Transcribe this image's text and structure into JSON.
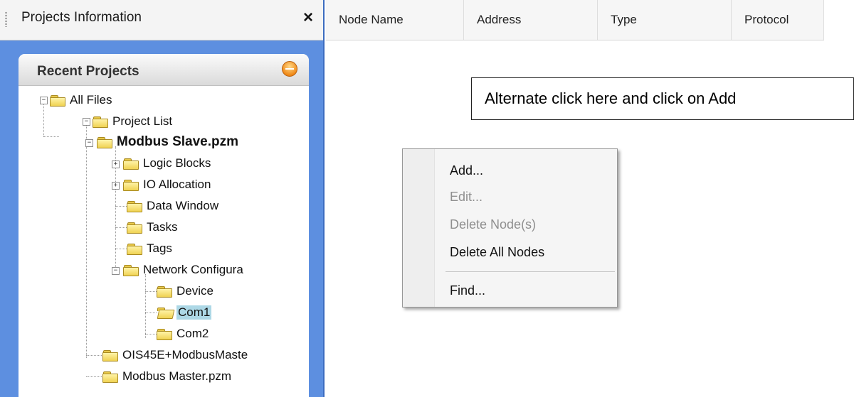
{
  "panel": {
    "title": "Projects Information",
    "close_label": "×"
  },
  "recent_projects": {
    "title": "Recent Projects"
  },
  "tree": {
    "all_files": "All Files",
    "project_list": "Project List",
    "project_name": "Modbus Slave.pzm",
    "logic_blocks": "Logic Blocks",
    "io_allocation": "IO Allocation",
    "data_window": "Data Window",
    "tasks": "Tasks",
    "tags": "Tags",
    "network_configuration": "Network Configura",
    "device": "Device",
    "com1": "Com1",
    "com2": "Com2",
    "ois45e": "OIS45E+ModbusMaste",
    "modbus_master": "Modbus Master.pzm"
  },
  "table": {
    "columns": [
      "Node Name",
      "Address",
      "Type",
      "Protocol"
    ]
  },
  "callout": {
    "text": "Alternate click here and click on Add"
  },
  "context_menu": {
    "items": [
      {
        "label": "Add...",
        "enabled": true
      },
      {
        "label": "Edit...",
        "enabled": false
      },
      {
        "label": "Delete Node(s)",
        "enabled": false
      },
      {
        "label": "Delete All Nodes",
        "enabled": true
      },
      {
        "label": "Find...",
        "enabled": true
      }
    ]
  },
  "colors": {
    "panel_background": "#5d8fe0",
    "selection": "#add8e6",
    "folder": "#f0d252"
  }
}
